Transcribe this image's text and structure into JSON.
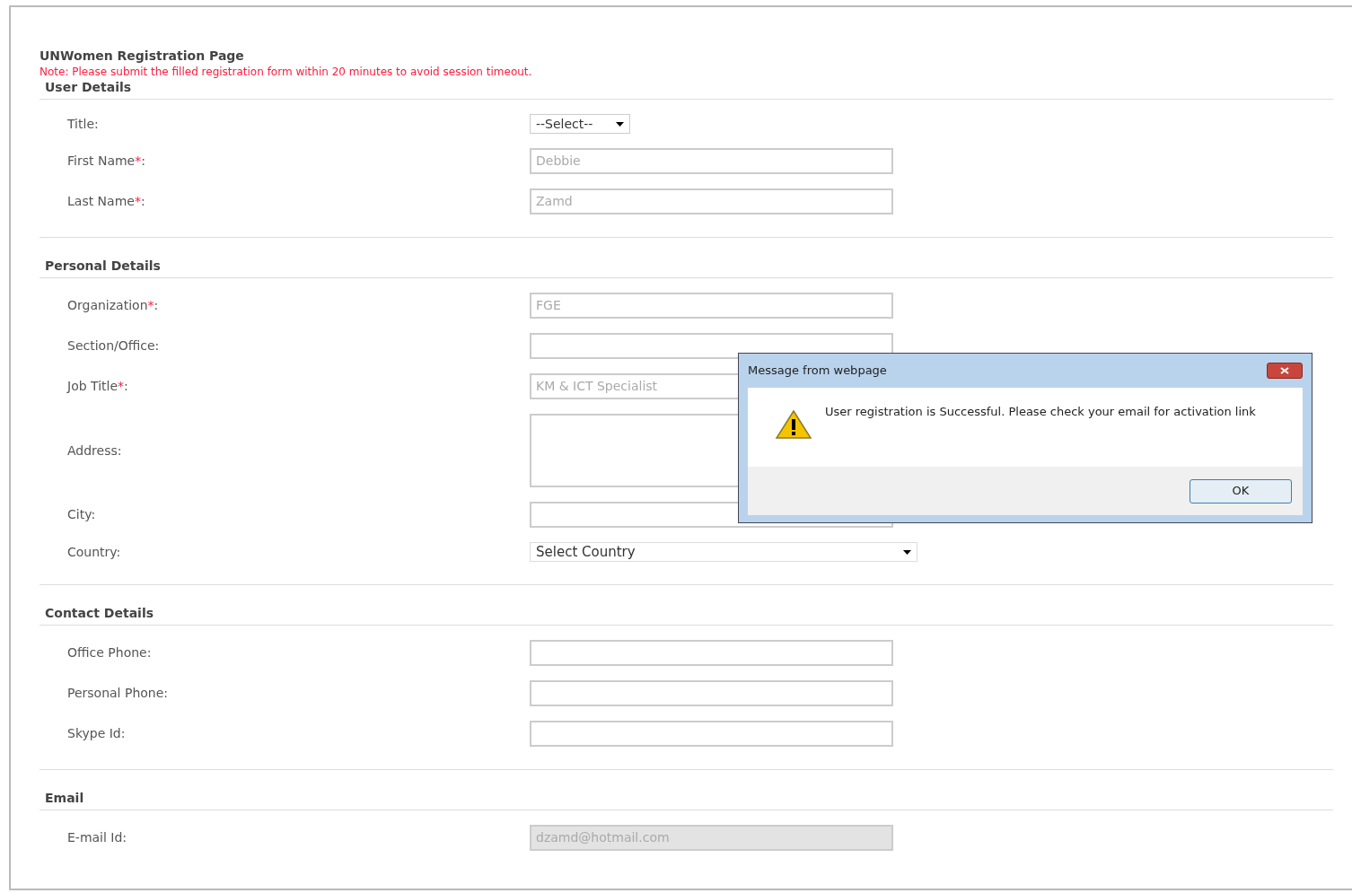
{
  "page": {
    "title": "UNWomen Registration Page",
    "note": "Note: Please submit the filled registration form within 20 minutes to avoid session timeout."
  },
  "sections": [
    {
      "heading": "User Details",
      "fields": [
        {
          "kind": "select",
          "label": "Title:",
          "value": "--Select--"
        },
        {
          "kind": "text",
          "label": "First Name",
          "required_mark": "*",
          "colon": ":",
          "value": "Debbie",
          "disabled": false
        },
        {
          "kind": "text",
          "label": "Last Name",
          "required_mark": "*",
          "colon": ":",
          "value": "Zamd",
          "disabled": false
        }
      ]
    },
    {
      "heading": "Personal Details",
      "fields": [
        {
          "kind": "text",
          "label": "Organization",
          "required_mark": "*",
          "colon": ":",
          "value": "FGE",
          "disabled": false
        },
        {
          "kind": "text",
          "label": "Section/Office:",
          "disabled": false
        },
        {
          "kind": "text",
          "label": "Job Title",
          "required_mark": "*",
          "colon": ":",
          "value": "KM & ICT Specialist",
          "disabled": false
        },
        {
          "kind": "textarea",
          "label": "Address:"
        },
        {
          "kind": "text",
          "label": "City:",
          "disabled": false
        },
        {
          "kind": "wideselect",
          "label": "Country:",
          "value": "Select Country"
        }
      ]
    },
    {
      "heading": "Contact Details",
      "fields": [
        {
          "kind": "text",
          "label": "Office Phone:",
          "disabled": false
        },
        {
          "kind": "text",
          "label": "Personal Phone:",
          "disabled": false
        },
        {
          "kind": "text",
          "label": "Skype Id:",
          "disabled": false
        }
      ]
    },
    {
      "heading": "Email",
      "fields": [
        {
          "kind": "text",
          "label": "E-mail Id:",
          "value": "dzamd@hotmail.com",
          "disabled": true
        }
      ]
    }
  ],
  "dialog": {
    "title": "Message from webpage",
    "message": "User registration is Successful. Please check your email for activation link",
    "button": "OK"
  }
}
